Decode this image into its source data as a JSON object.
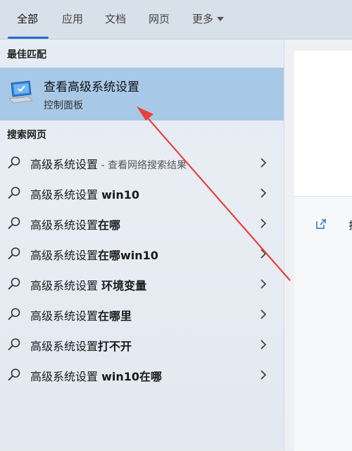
{
  "tabs": [
    {
      "label": "全部",
      "active": true
    },
    {
      "label": "应用",
      "active": false
    },
    {
      "label": "文档",
      "active": false
    },
    {
      "label": "网页",
      "active": false
    },
    {
      "label": "更多",
      "active": false
    }
  ],
  "sections": {
    "best_match": "最佳匹配",
    "web_search": "搜索网页"
  },
  "best_match": {
    "title": "查看高级系统设置",
    "subtitle": "控制面板",
    "icon": "computer-settings-icon"
  },
  "results": [
    {
      "base": "高级系统设置",
      "bold": "",
      "hint": " - 查看网络搜索结果"
    },
    {
      "base": "高级系统设置 ",
      "bold": "win10",
      "hint": ""
    },
    {
      "base": "高级系统设置",
      "bold": "在哪",
      "hint": ""
    },
    {
      "base": "高级系统设置",
      "bold": "在哪win10",
      "hint": ""
    },
    {
      "base": "高级系统设置 ",
      "bold": "环境变量",
      "hint": ""
    },
    {
      "base": "高级系统设置",
      "bold": "在哪里",
      "hint": ""
    },
    {
      "base": "高级系统设置",
      "bold": "打不开",
      "hint": ""
    },
    {
      "base": "高级系统设置 ",
      "bold": "win10在哪",
      "hint": ""
    }
  ],
  "right_panel": {
    "open_label": "打开",
    "open_icon": "open-external-icon"
  },
  "colors": {
    "accent": "#1f6fc9",
    "highlight": "#a8c8e8",
    "annotation_arrow": "#e8413a"
  }
}
